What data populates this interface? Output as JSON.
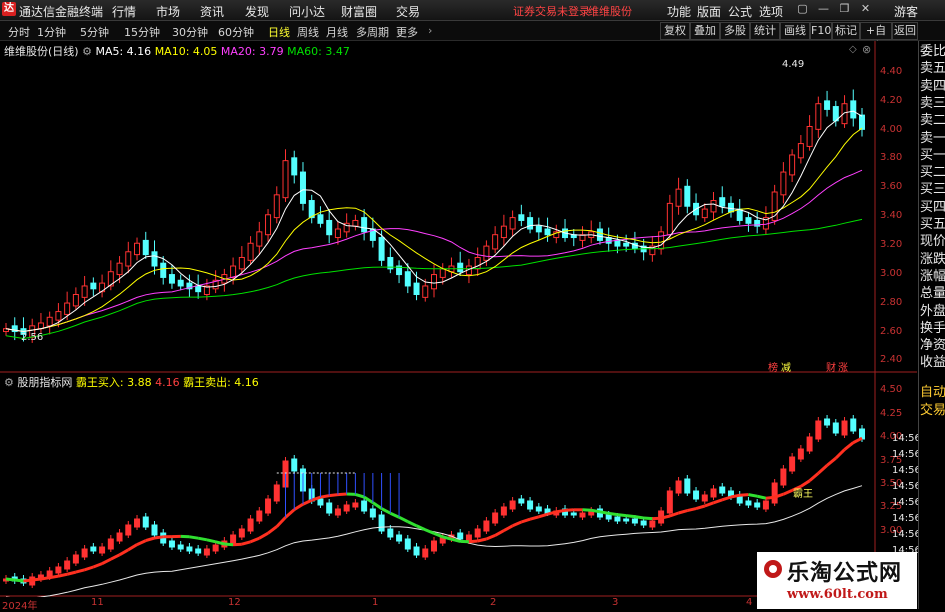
{
  "app": {
    "title": "通达信金融终端",
    "notice": "证券交易未登录",
    "stock_link": "维维股份",
    "guest": "游客"
  },
  "menu": [
    "行情",
    "市场",
    "资讯",
    "发现",
    "问小达",
    "财富圈",
    "交易"
  ],
  "right_menu": [
    "功能",
    "版面",
    "公式",
    "选项"
  ],
  "periods": [
    "分时",
    "1分钟",
    "5分钟",
    "15分钟",
    "30分钟",
    "60分钟",
    "日线",
    "周线",
    "月线",
    "多周期",
    "更多"
  ],
  "active_period": "日线",
  "toolbar_right": [
    "复权",
    "叠加",
    "多股",
    "统计",
    "画线",
    "F10",
    "标记",
    "+自选",
    "返回"
  ],
  "main_legend": {
    "stock": "维维股份(日线)",
    "ma5": "MA5: 4.16",
    "ma10": "MA10: 4.05",
    "ma20": "MA20: 3.79",
    "ma60": "MA60: 3.47"
  },
  "sub_legend": {
    "name": "股朋指标网",
    "buy": "霸王买入: 3.88",
    "val": "4.16",
    "sell": "霸王卖出: 4.16"
  },
  "annotations": {
    "high": "4.49",
    "low": "2.56",
    "bawang": "霸王",
    "tag1": "榜",
    "tag2": "减",
    "tag3": "财",
    "tag4": "涨"
  },
  "main_axis": [
    "4.40",
    "4.20",
    "4.00",
    "3.80",
    "3.60",
    "3.40",
    "3.20",
    "3.00",
    "2.80",
    "2.60",
    "2.40"
  ],
  "sub_axis": [
    "4.50",
    "4.25",
    "4.00",
    "3.75",
    "3.50",
    "3.25",
    "3.00"
  ],
  "sub_axis_times": [
    "14:56",
    "14:56",
    "14:56",
    "14:56",
    "14:56",
    "14:56",
    "14:56",
    "14:56"
  ],
  "dates": [
    "2024年",
    "11",
    "12",
    "1",
    "2",
    "3",
    "4"
  ],
  "right_panel_top": [
    "委比",
    "卖五",
    "卖四",
    "卖三",
    "卖二",
    "卖一",
    "买一",
    "买二",
    "买三",
    "买四",
    "买五",
    "现价",
    "涨跌",
    "涨幅",
    "总量",
    "外盘",
    "换手",
    "净资",
    "收益"
  ],
  "right_panel_bottom": [
    "自动",
    "交易"
  ],
  "watermark": {
    "title": "乐淘公式网",
    "url": "www.60lt.com"
  },
  "colors": {
    "up": "#ff3232",
    "down": "#54ffff",
    "ma5": "#ffffff",
    "ma10": "#ffff00",
    "ma20": "#ff40ff",
    "ma60": "#00e000"
  },
  "chart_data": {
    "type": "candlestick",
    "ylim_main": [
      2.4,
      4.5
    ],
    "ylim_sub": [
      2.9,
      4.55
    ],
    "close": [
      2.62,
      2.6,
      2.58,
      2.64,
      2.66,
      2.7,
      2.74,
      2.8,
      2.86,
      2.92,
      2.9,
      2.94,
      3.02,
      3.08,
      3.16,
      3.22,
      3.14,
      3.06,
      2.98,
      2.94,
      2.92,
      2.9,
      2.88,
      2.92,
      2.96,
      3.0,
      3.06,
      3.12,
      3.22,
      3.3,
      3.42,
      3.56,
      3.8,
      3.7,
      3.5,
      3.4,
      3.36,
      3.28,
      3.32,
      3.36,
      3.38,
      3.3,
      3.24,
      3.1,
      3.04,
      3.0,
      2.92,
      2.86,
      2.92,
      3.0,
      3.04,
      3.06,
      3.02,
      3.06,
      3.12,
      3.2,
      3.28,
      3.34,
      3.4,
      3.38,
      3.32,
      3.3,
      3.28,
      3.3,
      3.26,
      3.26,
      3.28,
      3.3,
      3.24,
      3.22,
      3.2,
      3.2,
      3.18,
      3.16,
      3.2,
      3.3,
      3.5,
      3.6,
      3.48,
      3.42,
      3.46,
      3.52,
      3.48,
      3.44,
      3.38,
      3.36,
      3.34,
      3.4,
      3.58,
      3.72,
      3.84,
      3.92,
      4.04,
      4.2,
      4.16,
      4.08,
      4.2,
      4.1,
      4.02
    ],
    "up": [
      1,
      0,
      0,
      1,
      1,
      1,
      1,
      1,
      1,
      1,
      0,
      1,
      1,
      1,
      1,
      1,
      0,
      0,
      0,
      0,
      0,
      0,
      0,
      1,
      1,
      1,
      1,
      1,
      1,
      1,
      1,
      1,
      1,
      0,
      0,
      0,
      0,
      0,
      1,
      1,
      1,
      0,
      0,
      0,
      0,
      0,
      0,
      0,
      1,
      1,
      1,
      1,
      0,
      1,
      1,
      1,
      1,
      1,
      1,
      0,
      0,
      0,
      0,
      1,
      0,
      0,
      1,
      1,
      0,
      0,
      0,
      0,
      0,
      0,
      1,
      1,
      1,
      1,
      0,
      0,
      1,
      1,
      0,
      0,
      0,
      0,
      0,
      1,
      1,
      1,
      1,
      1,
      1,
      1,
      0,
      0,
      1,
      0,
      0
    ]
  }
}
